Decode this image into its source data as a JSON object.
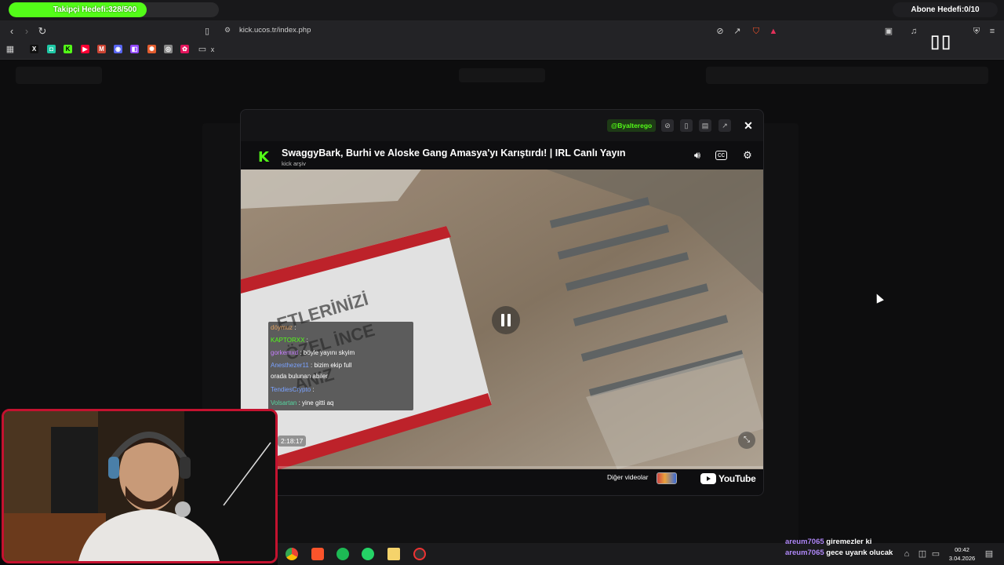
{
  "overlay": {
    "follower_goal": "Takipçi Hedefi:328/500",
    "follower_progress": 0.656,
    "sub_goal": "Abone Hedefi:0/10"
  },
  "browser": {
    "url": "kick.ucos.tr/index.php"
  },
  "modal": {
    "user_badge": "@Byalterego",
    "video_title": "SwaggyBark, Burhi ve Aloske Gang Amasya'yı Karıştırdı! | IRL Canlı Yayın",
    "video_subtitle": "kick arşiv",
    "timecode": "2:18:17",
    "other_videos_label": "Diğer videolar",
    "youtube_label": "YouTube"
  },
  "video_chat": [
    {
      "user": "döymuz",
      "text": ":",
      "color": "#e0a060"
    },
    {
      "user": "KAPTORXX",
      "text": ":",
      "color": "#53fc18"
    },
    {
      "user": "gorkemxd",
      "text": ": böyle yayını skyim",
      "color": "#c77dff"
    },
    {
      "user": "Anesthezer11",
      "text": ": bizim ekip full",
      "color": "#7aa2ff"
    },
    {
      "user": "",
      "text": "orada bulunan abiler",
      "color": "#ffffff"
    },
    {
      "user": "TendiesCrypto",
      "text": ":",
      "color": "#7aa2ff"
    },
    {
      "user": "Volsartan",
      "text": ": yine gitti aq",
      "color": "#55d6a0"
    }
  ],
  "stream_chat": [
    {
      "user": "areum7065",
      "text": "giremezler ki"
    },
    {
      "user": "areum7065",
      "text": "gece uyarık olucak"
    }
  ],
  "clock": {
    "time": "00:42",
    "date": "3.04.2026"
  },
  "colors": {
    "kick_green": "#53fc18",
    "webcam_border": "#c4122f"
  }
}
